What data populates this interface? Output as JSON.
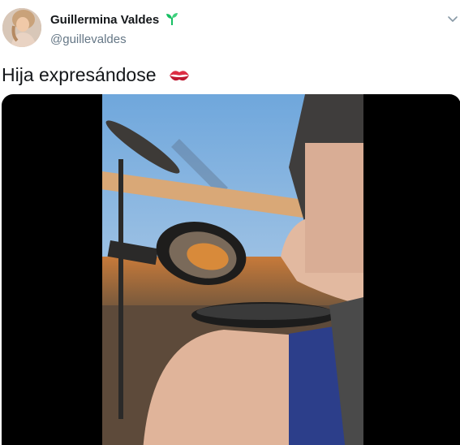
{
  "tweet": {
    "author": {
      "display_name": "Guillermina Valdes",
      "handle": "@guillevaldes",
      "name_emoji": "seedling-icon"
    },
    "text": "Hija expresándose",
    "text_emoji": "kiss-mark-icon",
    "menu_icon": "chevron-down-icon",
    "media": {
      "type": "video",
      "background": "#000000"
    }
  },
  "colors": {
    "name": "#14171a",
    "handle": "#657786",
    "text": "#14171a",
    "sprout": "#17bf63",
    "kiss": "#dd2e44"
  }
}
